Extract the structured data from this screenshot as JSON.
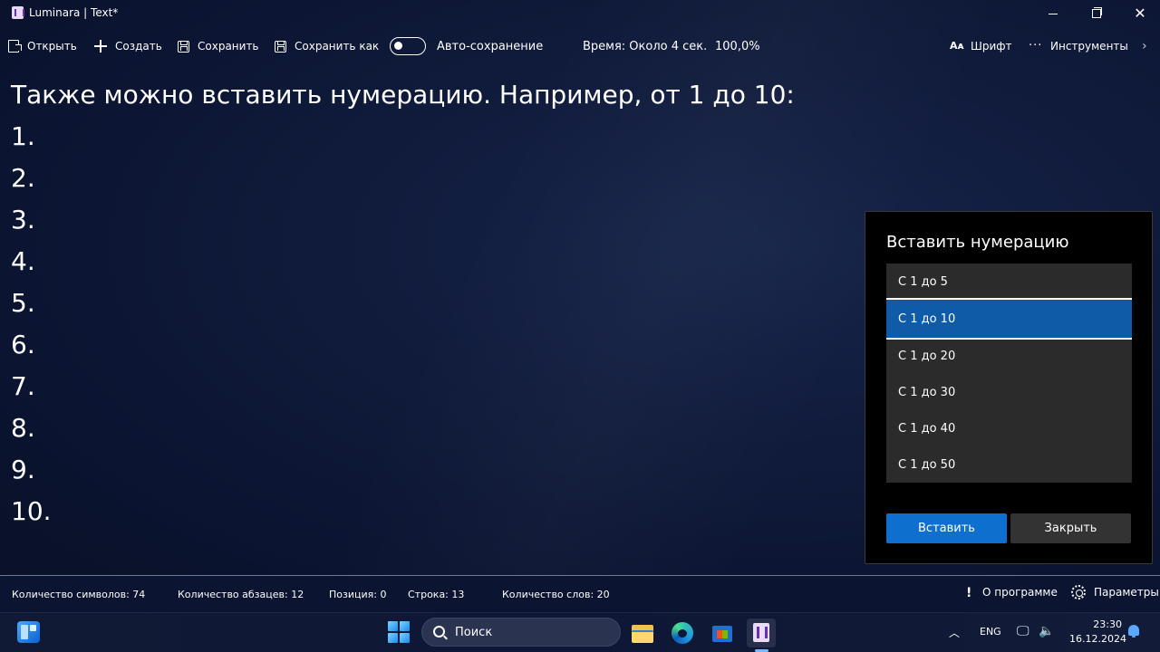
{
  "window": {
    "title": "Luminara | Text*",
    "minimize_glyph": "",
    "close_glyph": "✕"
  },
  "toolbar": {
    "open_label": "Открыть",
    "create_label": "Создать",
    "save_label": "Сохранить",
    "save_as_label": "Сохранить как",
    "autosave_label": "Авто-сохранение",
    "autosave_enabled": false,
    "time_label": "Время: Около 4 сек.",
    "zoom_label": "100,0%",
    "font_icon_glyph": "Aᴀ",
    "font_label": "Шрифт",
    "tools_icon_glyph": "···",
    "tools_label": "Инструменты",
    "more_glyph": "›"
  },
  "editor": {
    "lines": [
      "Также можно вставить нумерацию. Например, от 1 до 10:",
      "1.",
      "2.",
      "3.",
      "4.",
      "5.",
      "6.",
      "7.",
      "8.",
      "9.",
      "10."
    ]
  },
  "dialog": {
    "title": "Вставить нумерацию",
    "options": [
      "С 1 до 5",
      "С 1 до 10",
      "С 1 до 20",
      "С 1 до 30",
      "С 1 до 40",
      "С 1 до 50"
    ],
    "selected_index": 1,
    "insert_label": "Вставить",
    "close_label": "Закрыть",
    "accent_color": "#0f5ba7"
  },
  "statusbar": {
    "chars": "Количество символов: 74",
    "paragraphs": "Количество абзацев: 12",
    "position": "Позиция: 0",
    "line": "Строка: 13",
    "words": "Количество слов: 20",
    "about_glyph": "!",
    "about_label": "О программе",
    "settings_label": "Параметры"
  },
  "taskbar": {
    "search_placeholder": "Поиск",
    "tray_chevron_glyph": "︿",
    "language": "ENG",
    "network_glyph": "🖵",
    "volume_glyph": "🔈",
    "time": "23:30",
    "date": "16.12.2024",
    "icons": [
      "widgets-icon",
      "start-icon",
      "file-explorer-icon",
      "edge-icon",
      "store-icon",
      "luminara-icon"
    ]
  }
}
